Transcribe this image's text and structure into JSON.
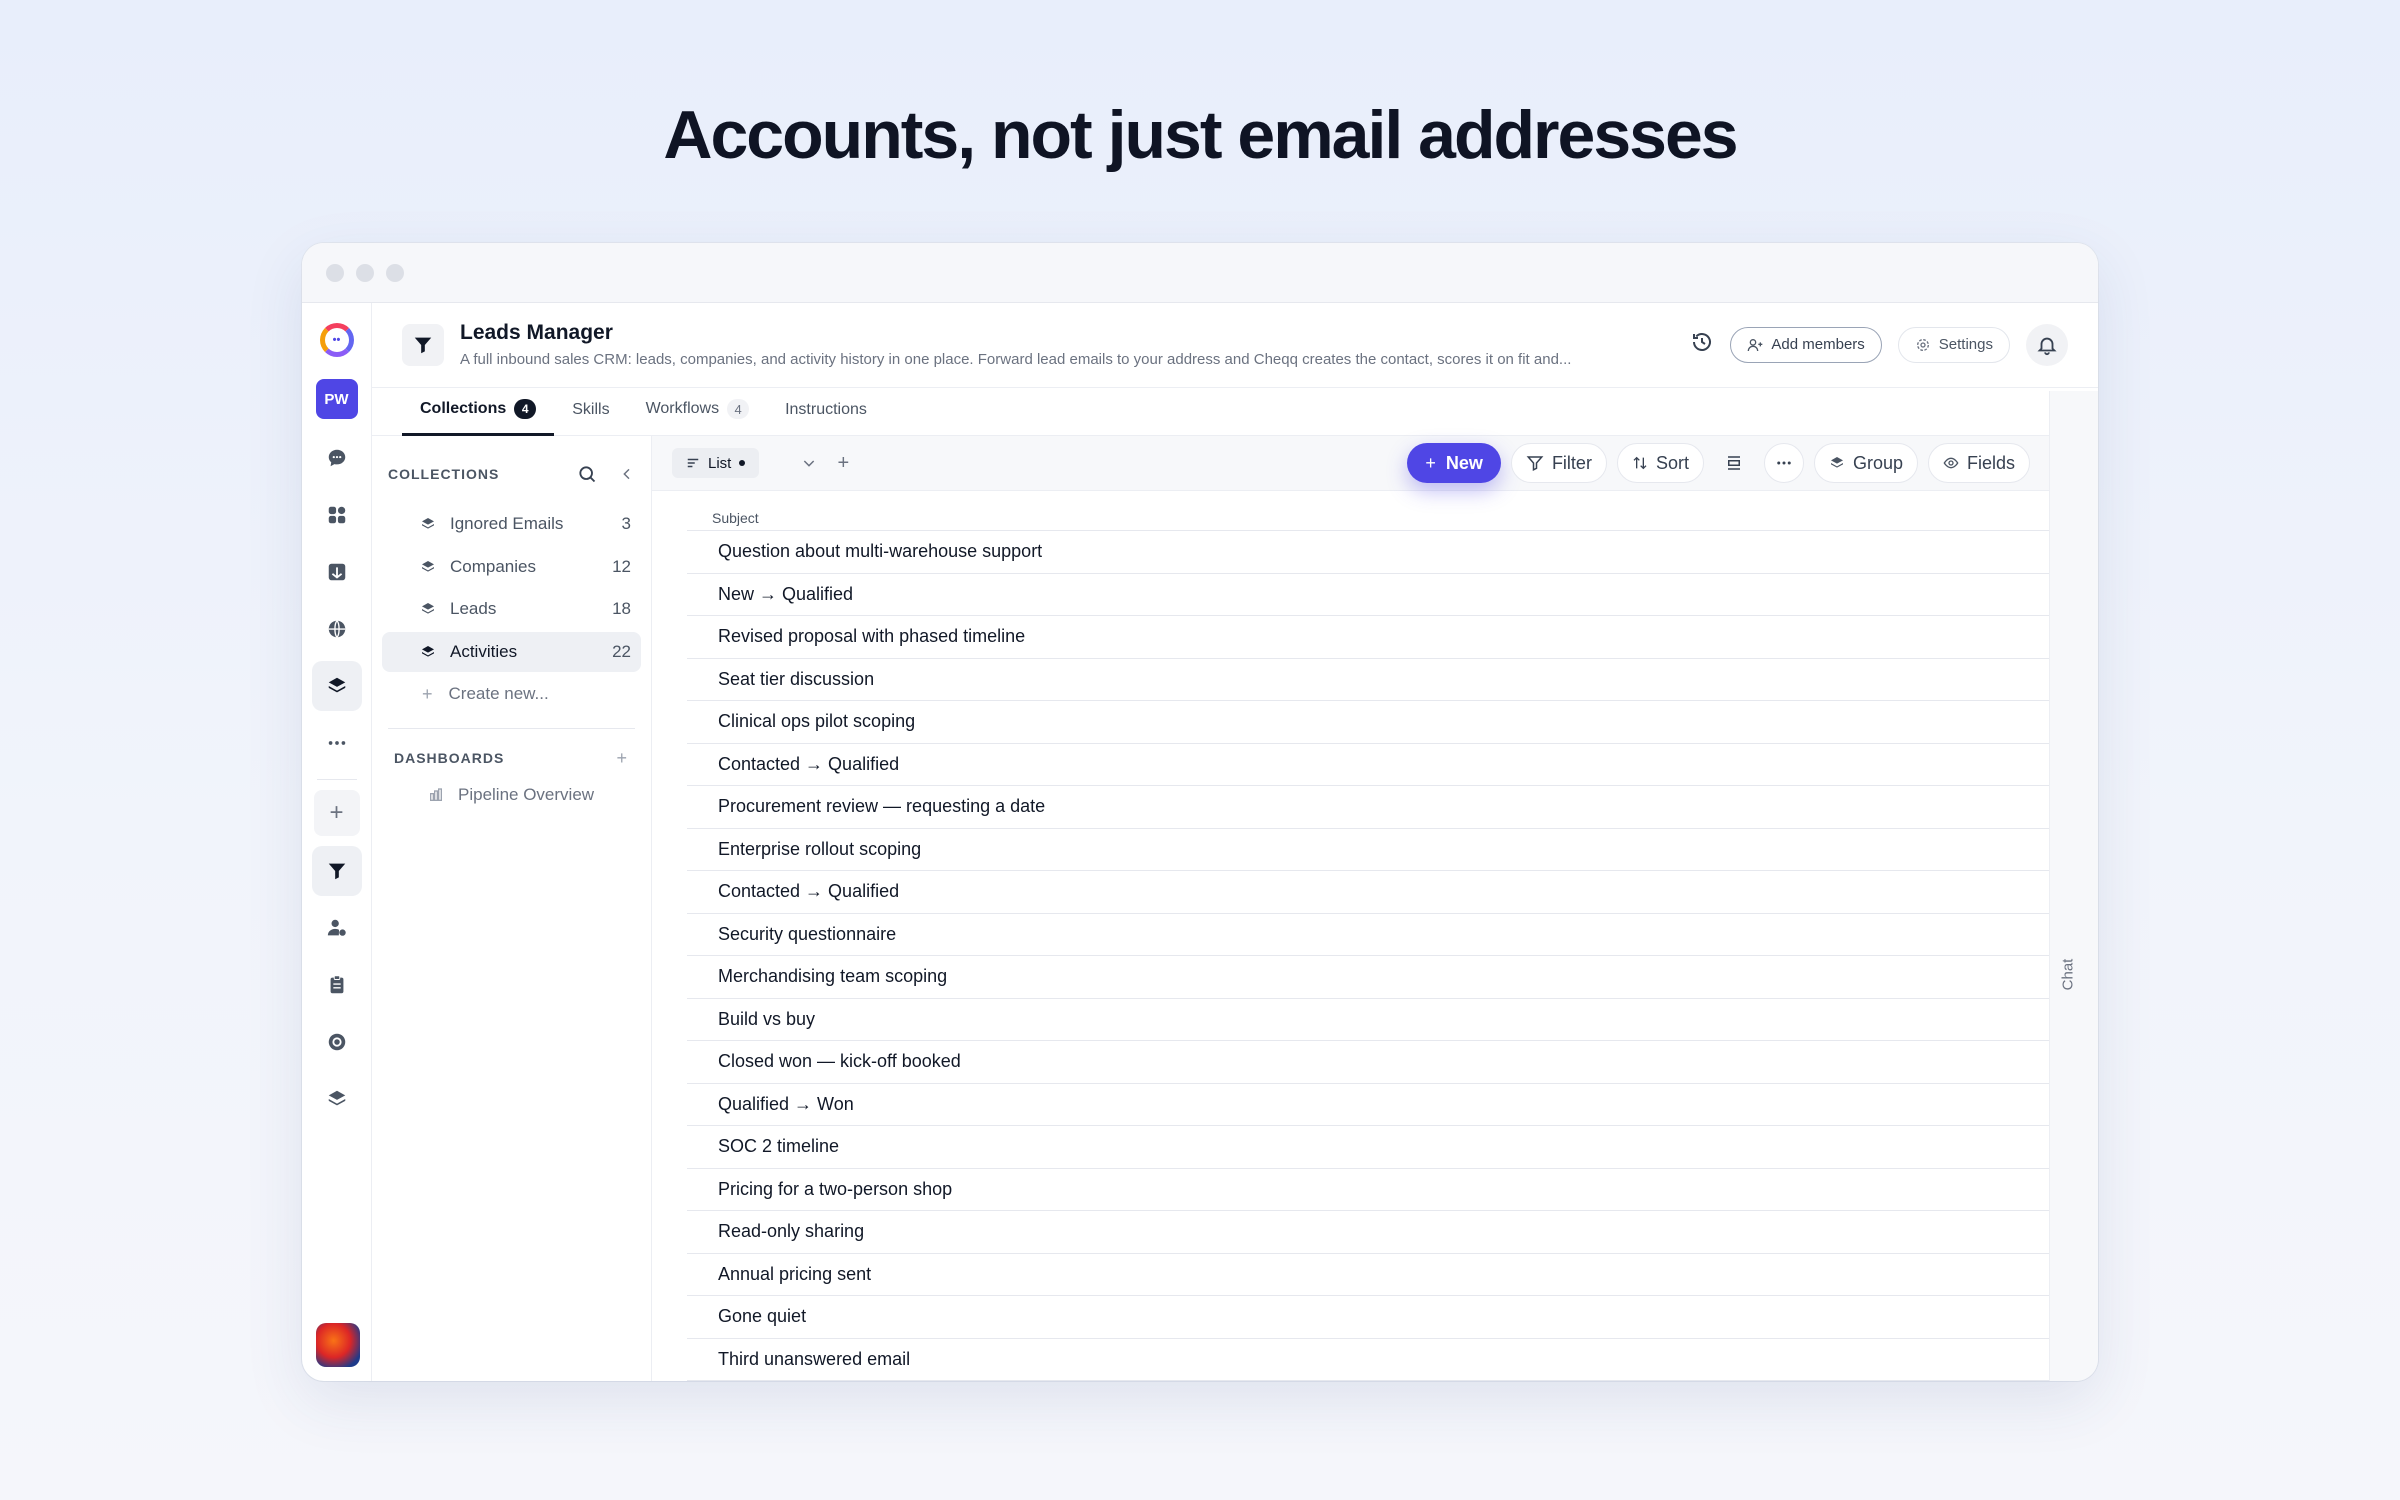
{
  "hero": {
    "title": "Accounts, not just email addresses"
  },
  "rail": {
    "workspace_initials": "PW"
  },
  "header": {
    "title": "Leads Manager",
    "description": "A full inbound sales CRM: leads, companies, and activity history in one place. Forward lead emails to your address and Cheqq creates the contact, scores it on fit and...",
    "add_members_label": "Add members",
    "settings_label": "Settings"
  },
  "tabs": [
    {
      "label": "Collections",
      "count": "4"
    },
    {
      "label": "Skills"
    },
    {
      "label": "Workflows",
      "count": "4"
    },
    {
      "label": "Instructions"
    }
  ],
  "collections": {
    "heading": "COLLECTIONS",
    "items": [
      {
        "name": "Ignored Emails",
        "count": "3"
      },
      {
        "name": "Companies",
        "count": "12"
      },
      {
        "name": "Leads",
        "count": "18"
      },
      {
        "name": "Activities",
        "count": "22"
      }
    ],
    "create_label": "Create new...",
    "dashboards_heading": "DASHBOARDS",
    "dashboards": [
      {
        "name": "Pipeline Overview"
      }
    ]
  },
  "toolbar": {
    "view_label": "List",
    "new_label": "New",
    "filter_label": "Filter",
    "sort_label": "Sort",
    "group_label": "Group",
    "fields_label": "Fields"
  },
  "table": {
    "column": "Subject",
    "rows": [
      "Question about multi-warehouse support",
      "New → Qualified",
      "Revised proposal with phased timeline",
      "Seat tier discussion",
      "Clinical ops pilot scoping",
      "Contacted → Qualified",
      "Procurement review — requesting a date",
      "Enterprise rollout scoping",
      "Contacted → Qualified",
      "Security questionnaire",
      "Merchandising team scoping",
      "Build vs buy",
      "Closed won — kick-off booked",
      "Qualified → Won",
      "SOC 2 timeline",
      "Pricing for a two-person shop",
      "Read-only sharing",
      "Annual pricing sent",
      "Gone quiet",
      "Third unanswered email"
    ]
  },
  "chat": {
    "label": "Chat"
  },
  "colors": {
    "accent": "#4f46e5",
    "text": "#111827",
    "muted": "#6b7280"
  },
  "icons": [
    "logo-icon",
    "chat-icon",
    "apps-icon",
    "inbox-icon",
    "globe-icon",
    "layers-icon",
    "more-icon",
    "plus-icon",
    "funnel-icon",
    "person-icon",
    "clipboard-icon",
    "target-icon",
    "stack-icon",
    "history-icon",
    "users-icon",
    "gear-icon",
    "bell-icon",
    "search-icon",
    "chevron-left-icon",
    "chart-icon",
    "list-icon",
    "chevron-down-icon",
    "filter-icon",
    "sort-icon",
    "row-height-icon",
    "eye-icon"
  ]
}
